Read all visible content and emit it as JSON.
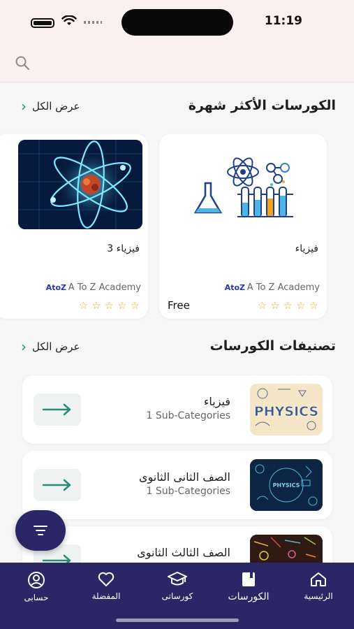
{
  "status_bar": {
    "time": "11:19"
  },
  "popular": {
    "title": "الكورسات الأكثر شهرة",
    "view_all": "عرض الكل",
    "courses": [
      {
        "title": "فيزياء",
        "provider": "A To Z Academy",
        "logo": "AtoZ",
        "price": "Free",
        "rating": 0
      },
      {
        "title": "فيزياء 3",
        "provider": "A To Z Academy",
        "logo": "AtoZ",
        "price": "",
        "rating": 0
      }
    ]
  },
  "categories": {
    "title": "تصنيفات الكورسات",
    "view_all": "عرض الكل",
    "items": [
      {
        "name": "فيزياء",
        "sub": "1 Sub-Categories",
        "thumb_text": "PHYSICS"
      },
      {
        "name": "الصف الثانى الثانوى",
        "sub": "1 Sub-Categories",
        "thumb_text": "PHYSICS"
      },
      {
        "name": "الصف الثالث الثانوى",
        "sub": "",
        "thumb_text": ""
      }
    ]
  },
  "bottom_nav": {
    "items": [
      {
        "label": "الرئيسية",
        "icon": "home-icon"
      },
      {
        "label": "الكورسات",
        "icon": "book-icon"
      },
      {
        "label": "كورساتى",
        "icon": "graduation-cap-icon"
      },
      {
        "label": "المفضلة",
        "icon": "heart-icon"
      },
      {
        "label": "حسابى",
        "icon": "user-circle-icon"
      }
    ]
  },
  "colors": {
    "primary": "#2b2766",
    "accent": "#2b8a78",
    "star": "#e0b21f"
  }
}
